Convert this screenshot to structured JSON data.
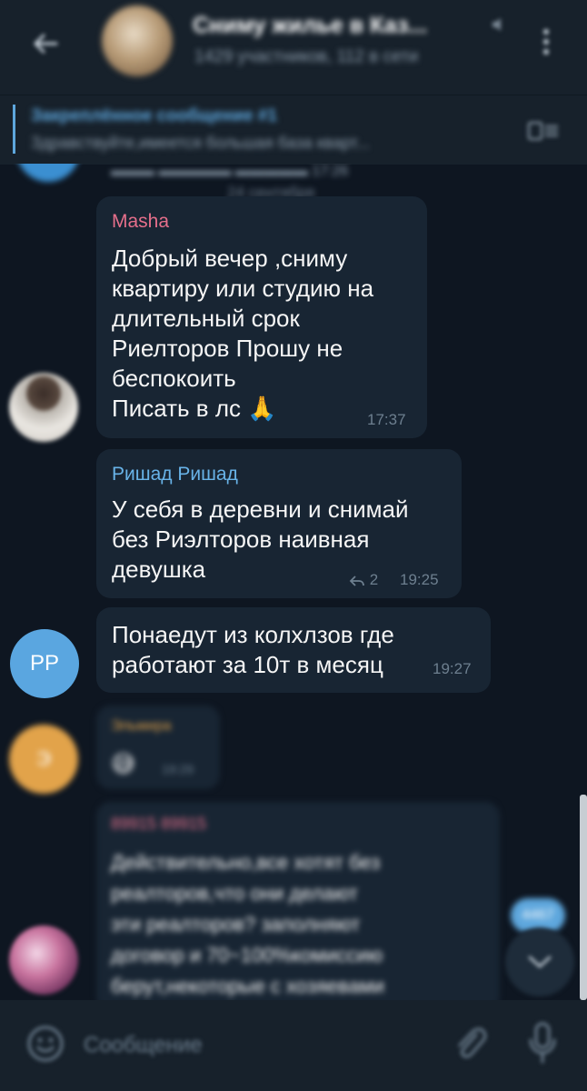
{
  "header": {
    "title": "Сниму жилье в Каз...",
    "subtitle": "1429 участников, 112 в сети"
  },
  "pinned": {
    "title": "Закреплённое сообщение #1",
    "text": "Здравствуйте,имеется большая база кварт..."
  },
  "date_chip": "24 сентября",
  "messages": [
    {
      "sender": "Masha",
      "sender_color": "#e56f8b",
      "text": "Добрый вечер ,сниму\nквартиру или студию на\nдлительный срок\nРиелторов Прошу не\nбеспокоить\nПисать в лс 🙏",
      "time": "17:37"
    },
    {
      "sender": "Ришад Ришад",
      "sender_color": "#68b3e8",
      "text": "У себя в деревни и снимай\nбез Риэлторов наивная\nдевушка",
      "replies": "2",
      "time": "19:25"
    },
    {
      "avatar_initials": "PP",
      "text": "Понаедут из колхлзов где\nработают за 10т в месяц",
      "time": "19:27"
    },
    {
      "sender": "Эльмира",
      "sender_color": "#e2a34a",
      "avatar_initials": "Э",
      "text": "😅",
      "time": "19:29"
    },
    {
      "sender": "89915 89915",
      "sender_color": "#e56f8b",
      "text": "Действительно,все хотят без\nреалторов,что они делают\nэти реалторов? заполняют\nдоговор и 70~100%комиссию\nберут,некоторые с хозяевами"
    }
  ],
  "unread_count": "4467",
  "input": {
    "placeholder": "Сообщение"
  },
  "colors": {
    "background": "#0e1621",
    "bubble": "#182533",
    "header": "#17212b",
    "accent": "#5ea7dd"
  }
}
